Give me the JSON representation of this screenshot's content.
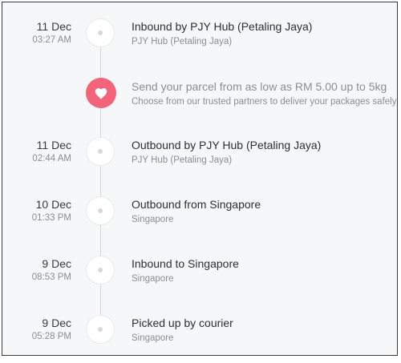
{
  "events": [
    {
      "date": "11 Dec",
      "time": "03:27 AM",
      "title": "Inbound by PJY Hub (Petaling Jaya)",
      "location": "PJY Hub (Petaling Jaya)"
    },
    {
      "date": "11 Dec",
      "time": "02:44 AM",
      "title": "Outbound by PJY Hub (Petaling Jaya)",
      "location": "PJY Hub (Petaling Jaya)"
    },
    {
      "date": "10 Dec",
      "time": "01:33 PM",
      "title": "Outbound from Singapore",
      "location": "Singapore"
    },
    {
      "date": "9 Dec",
      "time": "08:53 PM",
      "title": "Inbound to Singapore",
      "location": "Singapore"
    },
    {
      "date": "9 Dec",
      "time": "05:28 PM",
      "title": "Picked up by courier",
      "location": "Singapore"
    }
  ],
  "promo": {
    "title": "Send your parcel from as low as RM 5.00 up to 5kg",
    "subtitle": "Choose from our trusted partners to deliver your packages safely",
    "icon": "heart-icon",
    "accent_color": "#f2647a"
  }
}
